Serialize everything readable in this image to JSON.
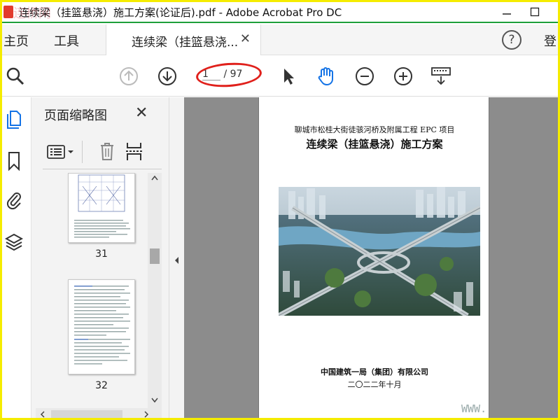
{
  "window": {
    "title": "连续梁（挂篮悬浇）施工方案(论证后).pdf - Adobe Acrobat Pro DC",
    "watermark": "连桥网",
    "minimize_icon": "minimize-icon",
    "close_icon": "close-icon"
  },
  "menubar": {
    "home_label": "主页",
    "tools_label": "工具",
    "doc_tab_label": "连续梁（挂篮悬浇...",
    "help_label": "?",
    "login_label": "登"
  },
  "toolbar": {
    "page_current": "1",
    "page_total": "/ 97",
    "icons": [
      "search-icon",
      "page-up-icon",
      "page-down-icon",
      "select-cursor-icon",
      "hand-tool-icon",
      "zoom-out-icon",
      "zoom-in-icon",
      "scroll-keyboard-icon"
    ]
  },
  "thumbnail_panel": {
    "title": "页面缩略图",
    "pages": [
      "31",
      "32"
    ]
  },
  "document": {
    "project_line": "聊城市松桂大街徒骇河桥及附属工程 EPC 项目",
    "doc_title": "连续梁（挂篮悬浇）施工方案",
    "company": "中国建筑一局（集团）有限公司",
    "date": "二〇二二年十月"
  },
  "watermark_web": "WWW."
}
